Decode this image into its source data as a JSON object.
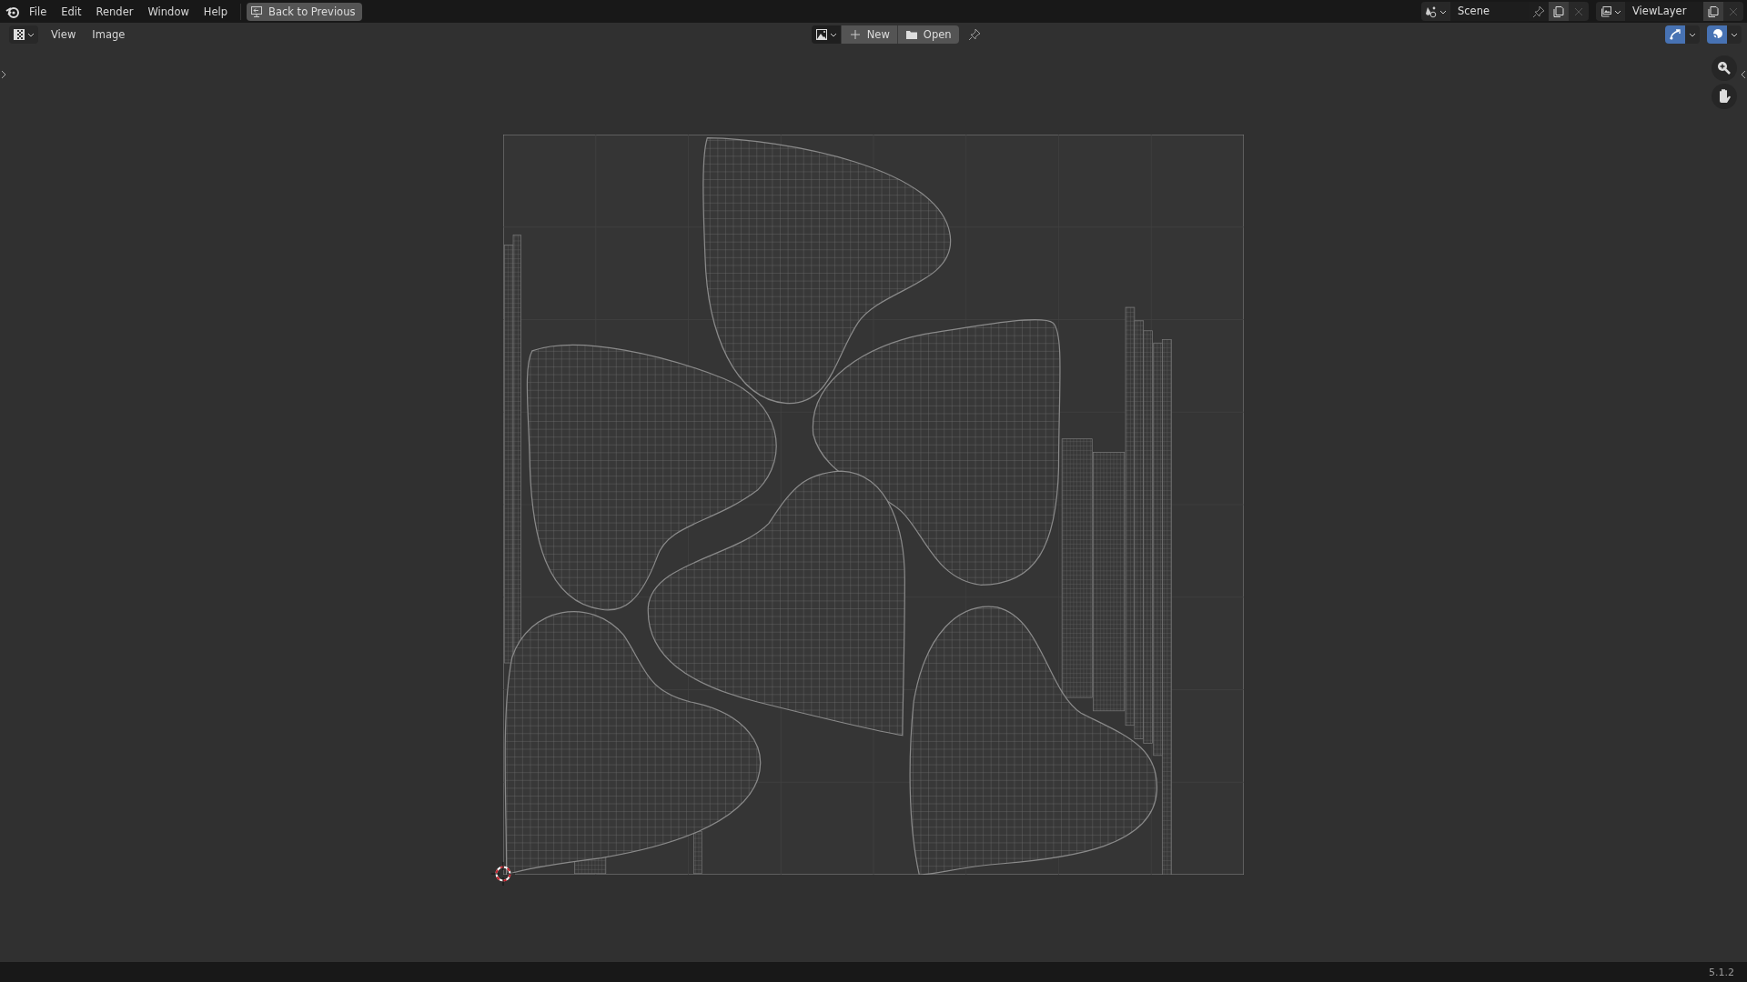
{
  "top_bar": {
    "menus": [
      "File",
      "Edit",
      "Render",
      "Window",
      "Help"
    ],
    "back_button": "Back to Previous",
    "scene": "Scene",
    "view_layer": "ViewLayer"
  },
  "editor_header": {
    "menus": [
      "View",
      "Image"
    ],
    "image_buttons": [
      {
        "kind": "new",
        "label": "New"
      },
      {
        "kind": "open",
        "label": "Open"
      }
    ],
    "toggles": [
      {
        "kind": "snap",
        "on": true
      },
      {
        "kind": "overlay",
        "on": true
      }
    ]
  },
  "status_bar": {
    "version": "5.1.2"
  }
}
